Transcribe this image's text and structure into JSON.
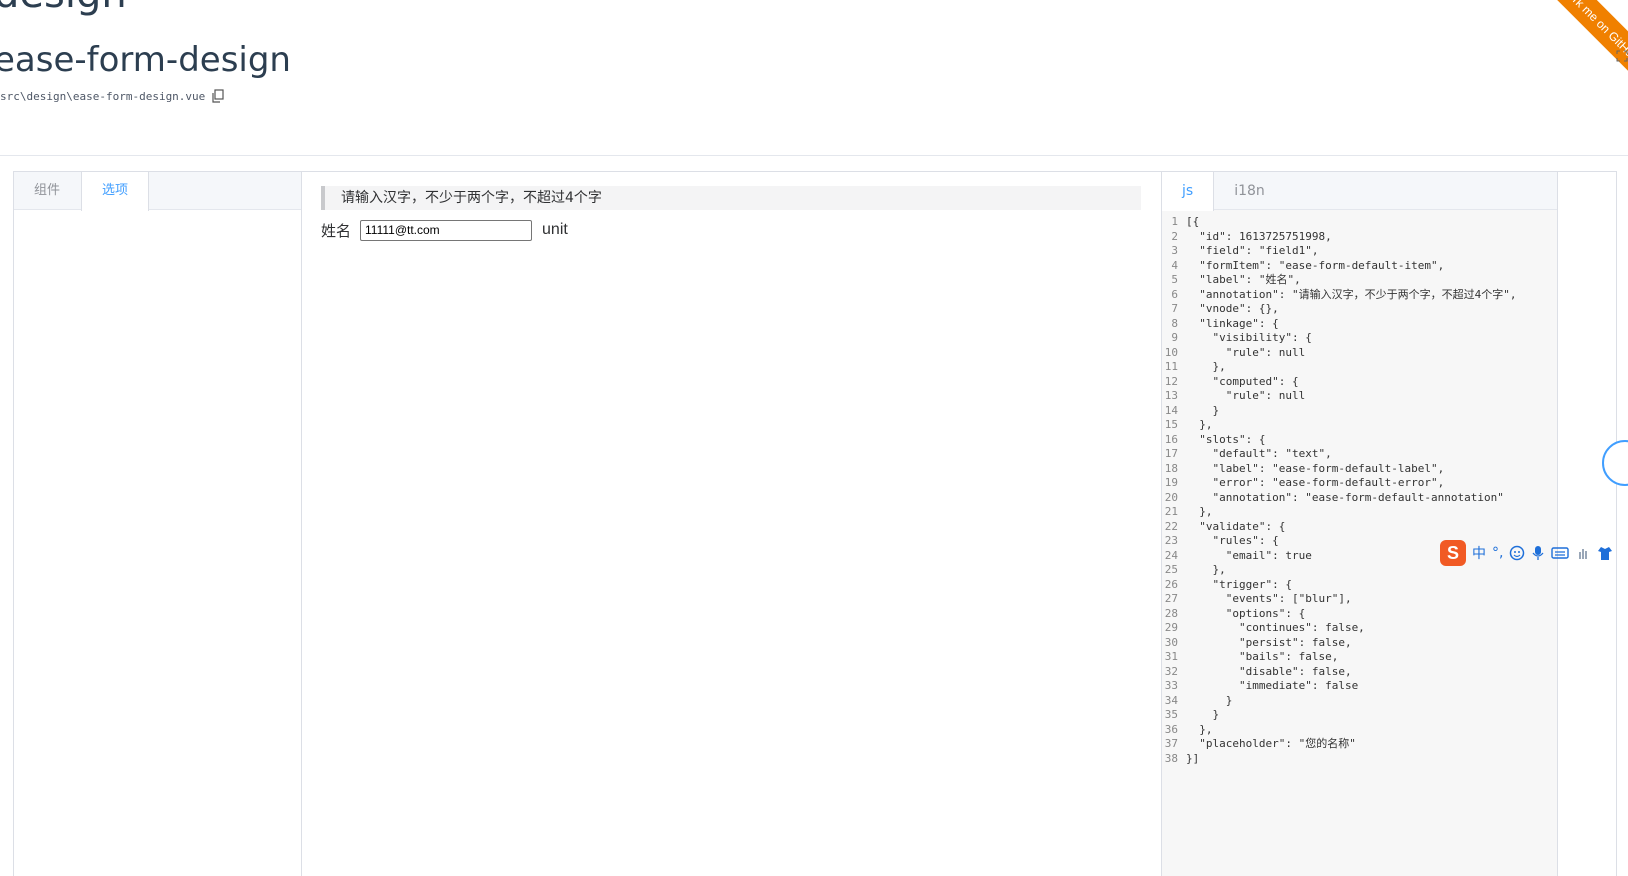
{
  "header": {
    "title_top": "design",
    "title_main": "ease-form-design",
    "path": "src\\design\\ease-form-design.vue",
    "ribbon_text": "Fork me on GitHub"
  },
  "left_panel": {
    "tabs": [
      {
        "label": "组件",
        "active": false
      },
      {
        "label": "选项",
        "active": true
      }
    ]
  },
  "form": {
    "annotation": "请输入汉字，不少于两个字，不超过4个字",
    "label": "姓名",
    "input_value": "11111@tt.com",
    "unit": "unit"
  },
  "right_panel": {
    "tabs": [
      {
        "label": "js",
        "active": true
      },
      {
        "label": "i18n",
        "active": false
      }
    ],
    "code_lines": [
      "[{",
      "  \"id\": 1613725751998,",
      "  \"field\": \"field1\",",
      "  \"formItem\": \"ease-form-default-item\",",
      "  \"label\": \"姓名\",",
      "  \"annotation\": \"请输入汉字，不少于两个字，不超过4个字\",",
      "  \"vnode\": {},",
      "  \"linkage\": {",
      "    \"visibility\": {",
      "      \"rule\": null",
      "    },",
      "    \"computed\": {",
      "      \"rule\": null",
      "    }",
      "  },",
      "  \"slots\": {",
      "    \"default\": \"text\",",
      "    \"label\": \"ease-form-default-label\",",
      "    \"error\": \"ease-form-default-error\",",
      "    \"annotation\": \"ease-form-default-annotation\"",
      "  },",
      "  \"validate\": {",
      "    \"rules\": {",
      "      \"email\": true",
      "    },",
      "    \"trigger\": {",
      "      \"events\": [\"blur\"],",
      "      \"options\": {",
      "        \"continues\": false,",
      "        \"persist\": false,",
      "        \"bails\": false,",
      "        \"disable\": false,",
      "        \"immediate\": false",
      "      }",
      "    }",
      "  },",
      "  \"placeholder\": \"您的名称\"",
      "}]"
    ]
  },
  "ime": {
    "logo": "S",
    "mode": "中",
    "punct": "°,"
  },
  "colors": {
    "accent": "#409eff",
    "ribbon": "#f08000",
    "annotation_bg": "#f4f4f5"
  }
}
